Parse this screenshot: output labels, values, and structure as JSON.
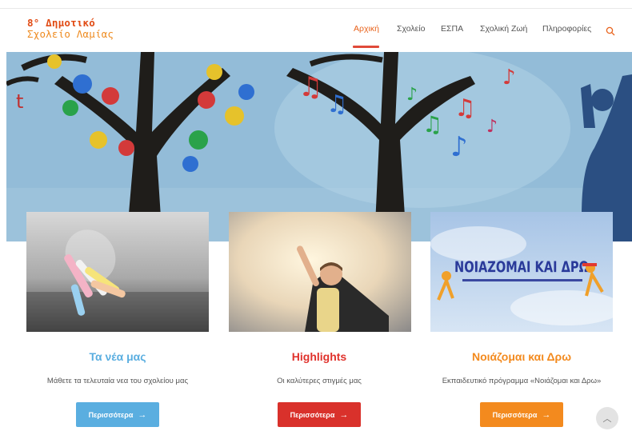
{
  "logo": {
    "line1": "8° Δημοτικό",
    "line2": "Σχολείο Λαμίας"
  },
  "nav": {
    "items": [
      "Αρχική",
      "Σχολείο",
      "ΕΣΠΑ",
      "Σχολική Ζωή",
      "Πληροφορίες"
    ],
    "active": "Αρχική",
    "search_icon": "search-icon"
  },
  "colors": {
    "accent": "#e8621b",
    "blue": "#5aaee0",
    "red": "#e0322c",
    "orange": "#f38a1e"
  },
  "cards": [
    {
      "title": "Τα νέα μας",
      "desc": "Μάθετε τα τελευταία νεα του σχολείου μας",
      "button": "Περισσότερα",
      "color": "#5aaee0",
      "image": "chalk-cup-photo"
    },
    {
      "title": "Highlights",
      "desc": "Οι καλύτερες στιγμές μας",
      "button": "Περισσότερα",
      "color": "#d9312b",
      "image": "child-superhero-photo"
    },
    {
      "title": "Νοιάζομαι και Δρω",
      "desc": "Εκπαιδευτικό πρόγραμμα «Νοιάζομαι και Δρω»",
      "button": "Περισσότερα",
      "color": "#f38a1e",
      "image": "noiazomai-kai-dro-logo"
    }
  ],
  "noiazomai_logo_text": "ΝΟΙΑΖΟΜΑΙ ΚΑΙ ΔΡΩ",
  "back_to_top_icon": "chevron-up-icon"
}
